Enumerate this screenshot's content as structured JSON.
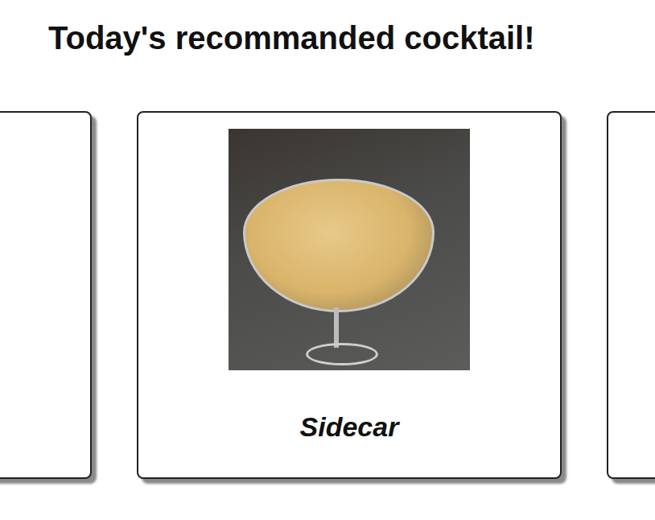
{
  "page": {
    "title": "Today's recommanded cocktail!"
  },
  "cards": [
    {
      "name": "",
      "selected": false
    },
    {
      "name": "Sidecar",
      "selected": true
    },
    {
      "name": "",
      "selected": false
    }
  ]
}
